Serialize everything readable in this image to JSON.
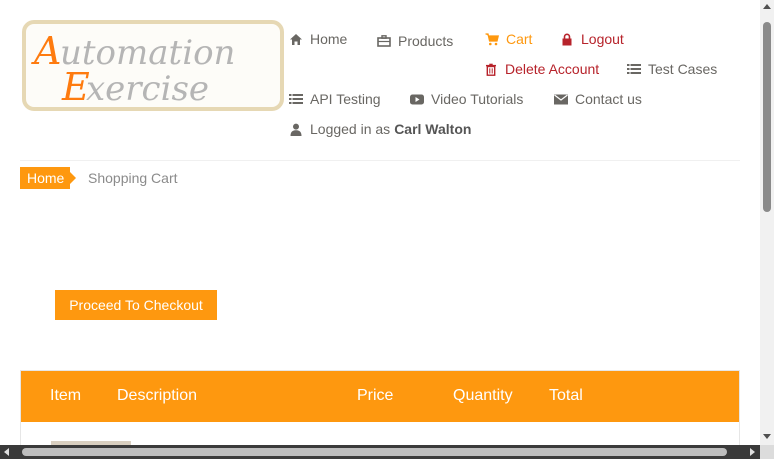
{
  "logo": {
    "line1_initial": "A",
    "line1_rest": "utomation",
    "line2_initial": "E",
    "line2_rest": "xercise"
  },
  "nav": {
    "home": "Home",
    "products": "Products",
    "cart": "Cart",
    "logout": "Logout",
    "delete_account": "Delete Account",
    "test_cases": "Test Cases",
    "api_testing": "API Testing",
    "video_tutorials": "Video Tutorials",
    "contact_us": "Contact us",
    "logged_in_prefix": "Logged in as",
    "username": "Carl Walton"
  },
  "breadcrumb": {
    "home": "Home",
    "current": "Shopping Cart"
  },
  "checkout_label": "Proceed To Checkout",
  "table": {
    "headers": [
      "Item",
      "Description",
      "Price",
      "Quantity",
      "Total"
    ]
  },
  "colors": {
    "accent": "#fe980f",
    "danger": "#b7232b",
    "text": "#696763"
  },
  "icons": {
    "home": "home-icon",
    "products": "briefcase-icon",
    "cart": "cart-icon",
    "logout": "lock-icon",
    "delete_account": "trash-icon",
    "test_cases": "list-icon",
    "api_testing": "list-icon",
    "video_tutorials": "youtube-icon",
    "contact_us": "envelope-icon",
    "user": "user-icon"
  }
}
